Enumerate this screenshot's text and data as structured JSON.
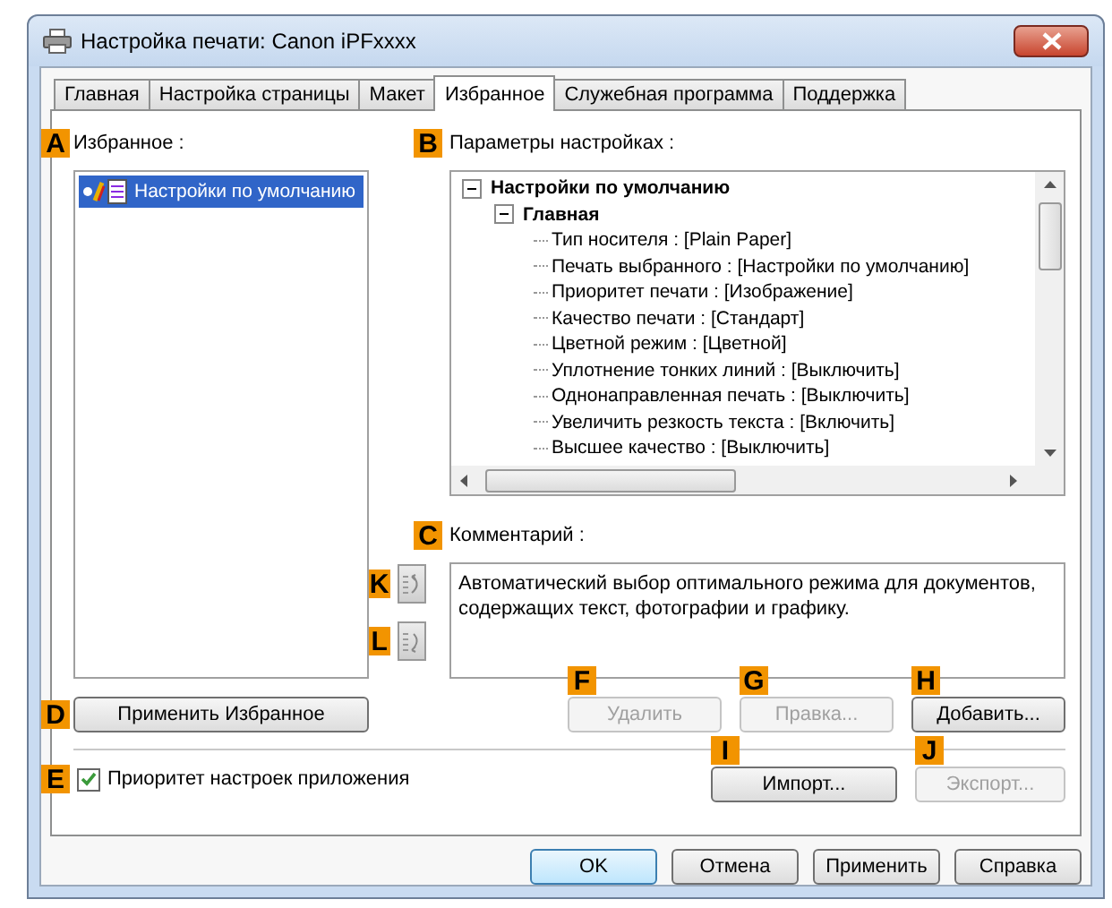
{
  "window": {
    "title": "Настройка печати: Canon iPFxxxx"
  },
  "tabs": [
    {
      "label": "Главная",
      "selected": false
    },
    {
      "label": "Настройка страницы",
      "selected": false
    },
    {
      "label": "Макет",
      "selected": false
    },
    {
      "label": "Избранное",
      "selected": true
    },
    {
      "label": "Служебная программа",
      "selected": false
    },
    {
      "label": "Поддержка",
      "selected": false
    }
  ],
  "favorites": {
    "callout": "A",
    "label": "Избранное :",
    "items": [
      {
        "label": "Настройки по умолчанию",
        "selected": true
      }
    ]
  },
  "settings": {
    "callout": "B",
    "label": "Параметры настройках :",
    "tree": [
      {
        "label": "Настройки по умолчанию",
        "expanded": true,
        "children": [
          {
            "label": "Главная",
            "expanded": true,
            "children": [
              {
                "label": "Тип носителя : [Plain Paper]"
              },
              {
                "label": "Печать выбранного : [Настройки по умолчанию]"
              },
              {
                "label": "Приоритет печати : [Изображение]"
              },
              {
                "label": "Качество печати : [Стандарт]"
              },
              {
                "label": "Цветной режим : [Цветной]"
              },
              {
                "label": "Уплотнение тонких линий : [Выключить]"
              },
              {
                "label": "Однонаправленная печать : [Выключить]"
              },
              {
                "label": "Увеличить резкость текста : [Включить]"
              },
              {
                "label": "Высшее качество : [Выключить]"
              }
            ]
          }
        ]
      }
    ]
  },
  "comment": {
    "callout": "C",
    "label": "Комментарий :",
    "text": "Автоматический выбор оптимального режима для документов, содержащих текст, фотографии и графику."
  },
  "move_buttons": [
    {
      "callout": "K",
      "kind": "up"
    },
    {
      "callout": "L",
      "kind": "down"
    }
  ],
  "apply_button": {
    "callout": "D",
    "label": "Применить Избранное"
  },
  "action_buttons": [
    {
      "callout": "F",
      "label": "Удалить",
      "disabled": true
    },
    {
      "callout": "G",
      "label": "Правка...",
      "disabled": true
    },
    {
      "callout": "H",
      "label": "Добавить...",
      "disabled": false
    }
  ],
  "app_priority": {
    "callout": "E",
    "label": "Приоритет настроек приложения",
    "checked": true
  },
  "io_buttons": [
    {
      "callout": "I",
      "label": "Импорт...",
      "disabled": false
    },
    {
      "callout": "J",
      "label": "Экспорт...",
      "disabled": true
    }
  ],
  "footer_buttons": [
    {
      "label": "OK",
      "focused": true
    },
    {
      "label": "Отмена",
      "focused": false
    },
    {
      "label": "Применить",
      "focused": false
    },
    {
      "label": "Справка",
      "focused": false
    }
  ]
}
